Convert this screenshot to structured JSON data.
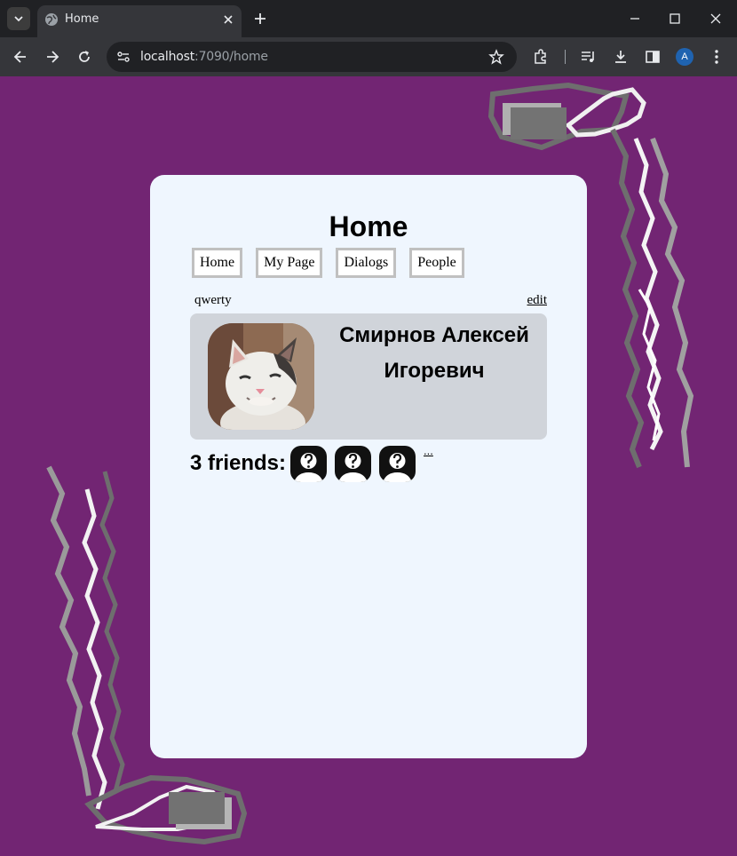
{
  "browser": {
    "tab_title": "Home",
    "url_host": "localhost",
    "url_rest": ":7090/home",
    "profile_initial": "A"
  },
  "page": {
    "title": "Home",
    "nav": [
      "Home",
      "My Page",
      "Dialogs",
      "People"
    ],
    "username": "qwerty",
    "edit_label": "edit",
    "full_name": "Смирнов Алексей Игоревич",
    "friends_label": "3 friends:",
    "friends_count": 3,
    "more_label": "..."
  },
  "colors": {
    "page_background": "#722573",
    "card_background": "#eff6fe",
    "profile_box": "#d0d4da"
  },
  "icons": {
    "avatar": "cat-photo",
    "friend": "unknown-person-icon"
  }
}
